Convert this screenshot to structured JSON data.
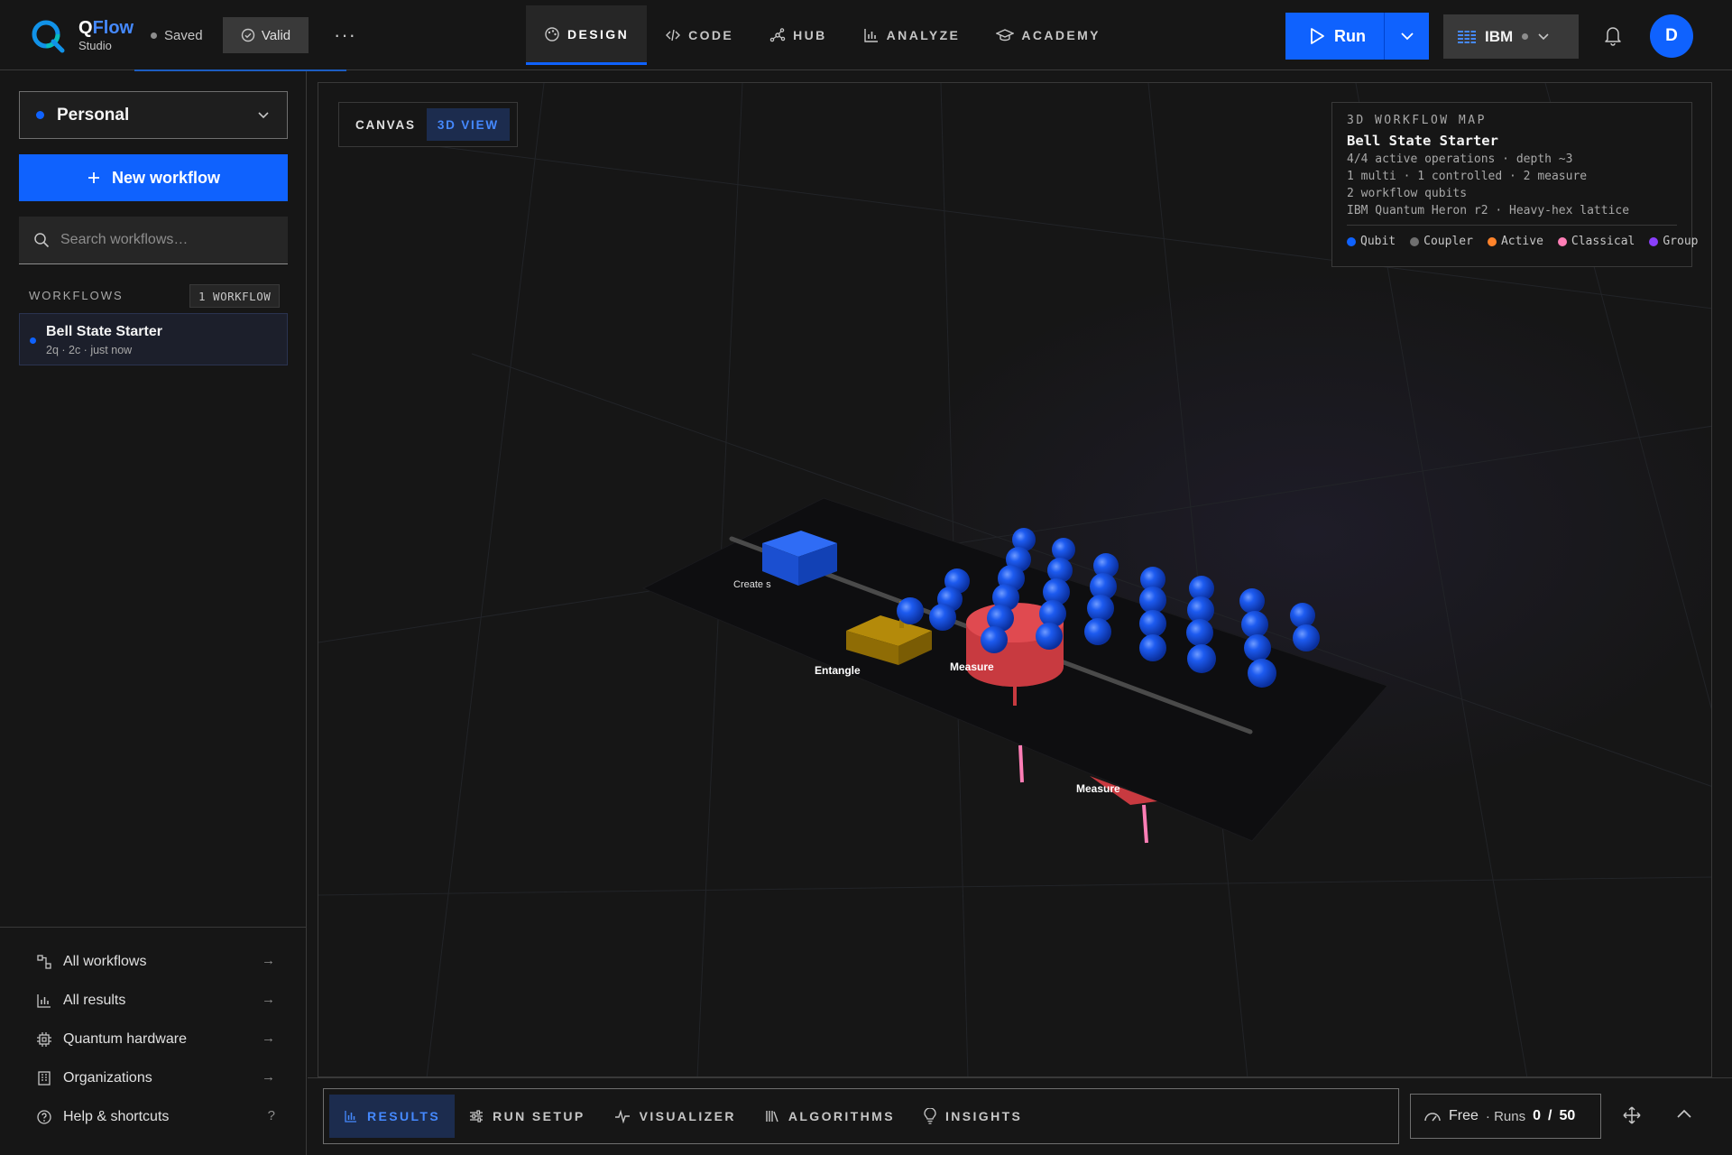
{
  "app": {
    "brand_prefix": "Q",
    "brand_name": "Flow",
    "brand_sub": "Studio",
    "saved_label": "Saved",
    "valid_label": "Valid",
    "more_label": "···"
  },
  "nav": {
    "tabs": [
      {
        "label": "DESIGN",
        "icon": "palette-icon",
        "active": true
      },
      {
        "label": "CODE",
        "icon": "code-icon",
        "active": false
      },
      {
        "label": "HUB",
        "icon": "hub-icon",
        "active": false
      },
      {
        "label": "ANALYZE",
        "icon": "bar-chart-icon",
        "active": false
      },
      {
        "label": "ACADEMY",
        "icon": "graduation-cap-icon",
        "active": false
      }
    ]
  },
  "toolbar": {
    "run_label": "Run",
    "backend_label": "IBM",
    "avatar_initial": "D"
  },
  "sidebar": {
    "workspace": "Personal",
    "new_workflow": "New workflow",
    "search_placeholder": "Search workflows…",
    "workflows_heading": "WORKFLOWS",
    "workflows_count": "1 WORKFLOW",
    "workflows": [
      {
        "name": "Bell State Starter",
        "meta": "2q  ·  2c  ·  just now"
      }
    ],
    "links": [
      {
        "label": "All workflows",
        "icon": "workflow-icon",
        "trail": "→"
      },
      {
        "label": "All results",
        "icon": "bar-chart-icon",
        "trail": "→"
      },
      {
        "label": "Quantum hardware",
        "icon": "chip-icon",
        "trail": "→"
      },
      {
        "label": "Organizations",
        "icon": "building-icon",
        "trail": "→"
      },
      {
        "label": "Help & shortcuts",
        "icon": "help-icon",
        "trail": "?"
      }
    ]
  },
  "view": {
    "toggle": [
      {
        "label": "CANVAS",
        "active": false
      },
      {
        "label": "3D VIEW",
        "active": true
      }
    ],
    "map": {
      "heading": "3D WORKFLOW MAP",
      "title": "Bell State Starter",
      "lines": [
        "4/4 active operations · depth ~3",
        "1 multi · 1 controlled · 2 measure",
        "2 workflow qubits",
        "IBM Quantum Heron r2 · Heavy-hex lattice"
      ],
      "legend": [
        {
          "label": "Qubit",
          "color": "#0f62fe"
        },
        {
          "label": "Coupler",
          "color": "#6f6f6f"
        },
        {
          "label": "Active",
          "color": "#ff832b"
        },
        {
          "label": "Classical",
          "color": "#ff7eb6"
        },
        {
          "label": "Group",
          "color": "#8a3ffc"
        }
      ]
    },
    "scene_labels": {
      "create": "Create s",
      "entangle": "Entangle",
      "measure_1": "Measure",
      "measure_2": "Measure"
    }
  },
  "bottom": {
    "tabs": [
      {
        "label": "RESULTS",
        "icon": "bar-chart-icon",
        "active": true
      },
      {
        "label": "RUN SETUP",
        "icon": "sliders-icon",
        "active": false
      },
      {
        "label": "VISUALIZER",
        "icon": "pulse-icon",
        "active": false
      },
      {
        "label": "ALGORITHMS",
        "icon": "library-icon",
        "active": false
      },
      {
        "label": "INSIGHTS",
        "icon": "lightbulb-icon",
        "active": false
      }
    ],
    "plan": {
      "tier": "Free",
      "runs_label": "· Runs",
      "runs_used": "0",
      "runs_sep": "/",
      "runs_total": "50"
    }
  }
}
